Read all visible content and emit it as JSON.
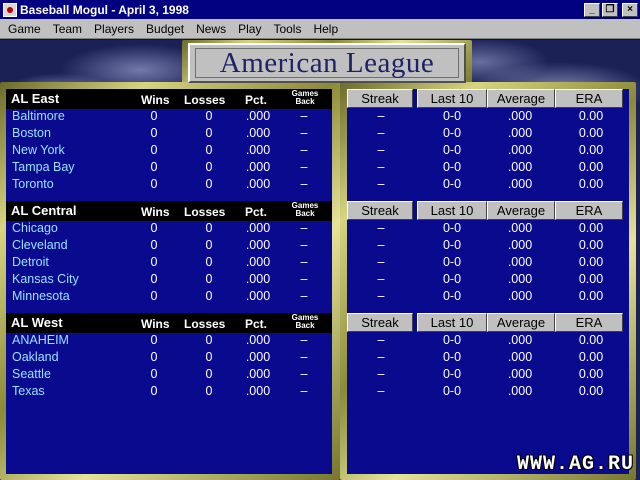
{
  "window": {
    "title": "Baseball Mogul - April 3, 1998"
  },
  "menu": [
    "Game",
    "Team",
    "Players",
    "Budget",
    "News",
    "Play",
    "Tools",
    "Help"
  ],
  "header": {
    "title": "American League"
  },
  "standings_columns": {
    "wins": "Wins",
    "losses": "Losses",
    "pct": "Pct.",
    "gb": "Games Back"
  },
  "stats_columns": {
    "streak": "Streak",
    "last10": "Last 10",
    "average": "Average",
    "era": "ERA"
  },
  "divisions": [
    {
      "name": "AL East",
      "teams": [
        {
          "name": "Baltimore",
          "wins": "0",
          "losses": "0",
          "pct": ".000",
          "gb": "–",
          "streak": "–",
          "last10": "0-0",
          "average": ".000",
          "era": "0.00"
        },
        {
          "name": "Boston",
          "wins": "0",
          "losses": "0",
          "pct": ".000",
          "gb": "–",
          "streak": "–",
          "last10": "0-0",
          "average": ".000",
          "era": "0.00"
        },
        {
          "name": "New York",
          "wins": "0",
          "losses": "0",
          "pct": ".000",
          "gb": "–",
          "streak": "–",
          "last10": "0-0",
          "average": ".000",
          "era": "0.00"
        },
        {
          "name": "Tampa Bay",
          "wins": "0",
          "losses": "0",
          "pct": ".000",
          "gb": "–",
          "streak": "–",
          "last10": "0-0",
          "average": ".000",
          "era": "0.00"
        },
        {
          "name": "Toronto",
          "wins": "0",
          "losses": "0",
          "pct": ".000",
          "gb": "–",
          "streak": "–",
          "last10": "0-0",
          "average": ".000",
          "era": "0.00"
        }
      ]
    },
    {
      "name": "AL Central",
      "teams": [
        {
          "name": "Chicago",
          "wins": "0",
          "losses": "0",
          "pct": ".000",
          "gb": "–",
          "streak": "–",
          "last10": "0-0",
          "average": ".000",
          "era": "0.00"
        },
        {
          "name": "Cleveland",
          "wins": "0",
          "losses": "0",
          "pct": ".000",
          "gb": "–",
          "streak": "–",
          "last10": "0-0",
          "average": ".000",
          "era": "0.00"
        },
        {
          "name": "Detroit",
          "wins": "0",
          "losses": "0",
          "pct": ".000",
          "gb": "–",
          "streak": "–",
          "last10": "0-0",
          "average": ".000",
          "era": "0.00"
        },
        {
          "name": "Kansas City",
          "wins": "0",
          "losses": "0",
          "pct": ".000",
          "gb": "–",
          "streak": "–",
          "last10": "0-0",
          "average": ".000",
          "era": "0.00"
        },
        {
          "name": "Minnesota",
          "wins": "0",
          "losses": "0",
          "pct": ".000",
          "gb": "–",
          "streak": "–",
          "last10": "0-0",
          "average": ".000",
          "era": "0.00"
        }
      ]
    },
    {
      "name": "AL West",
      "teams": [
        {
          "name": "ANAHEIM",
          "wins": "0",
          "losses": "0",
          "pct": ".000",
          "gb": "–",
          "streak": "–",
          "last10": "0-0",
          "average": ".000",
          "era": "0.00"
        },
        {
          "name": "Oakland",
          "wins": "0",
          "losses": "0",
          "pct": ".000",
          "gb": "–",
          "streak": "–",
          "last10": "0-0",
          "average": ".000",
          "era": "0.00"
        },
        {
          "name": "Seattle",
          "wins": "0",
          "losses": "0",
          "pct": ".000",
          "gb": "–",
          "streak": "–",
          "last10": "0-0",
          "average": ".000",
          "era": "0.00"
        },
        {
          "name": "Texas",
          "wins": "0",
          "losses": "0",
          "pct": ".000",
          "gb": "–",
          "streak": "–",
          "last10": "0-0",
          "average": ".000",
          "era": "0.00"
        }
      ]
    }
  ],
  "watermark": "WWW.AG.RU",
  "colors": {
    "panel": "#0a0a8e",
    "team_name": "#9de0ff",
    "title_bar": "#000080"
  }
}
